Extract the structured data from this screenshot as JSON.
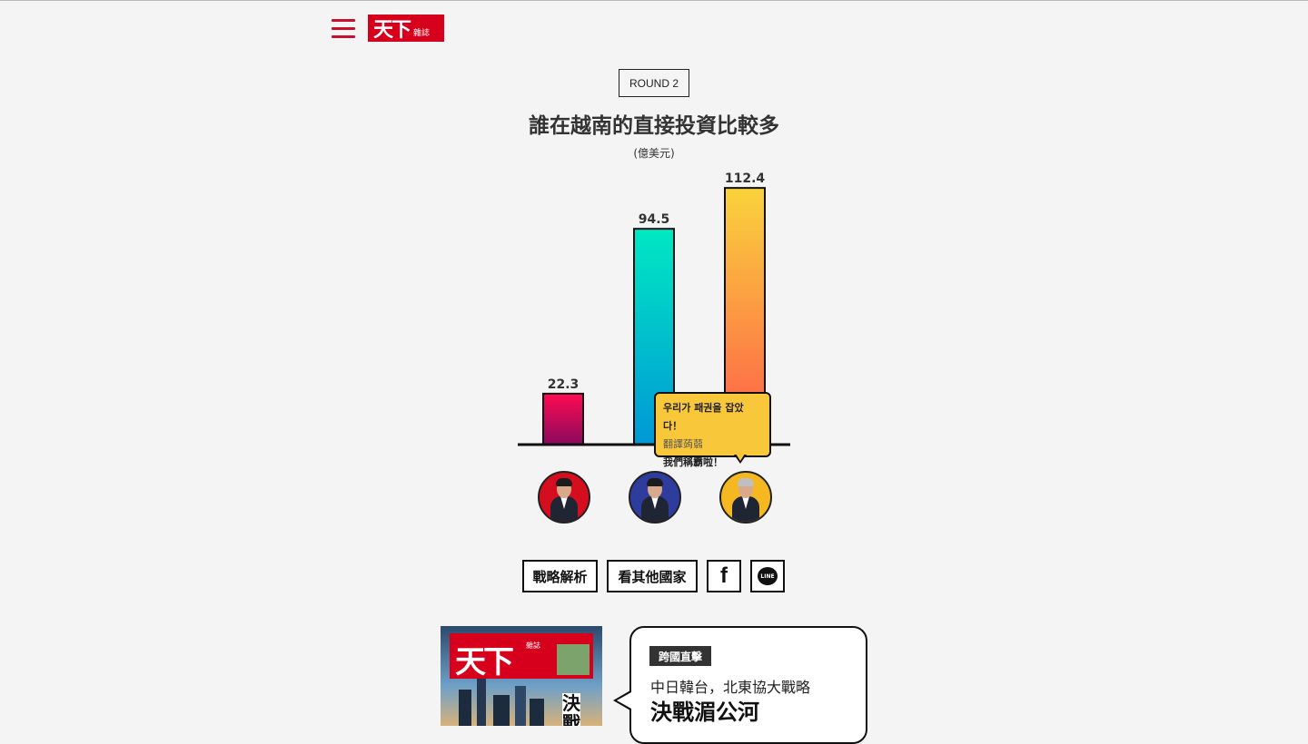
{
  "header": {
    "logo_main": "天下",
    "logo_small": "雜誌"
  },
  "round": "ROUND 2",
  "title": "誰在越南的直接投資比較多",
  "unit": "(億美元)",
  "chart_data": {
    "type": "bar",
    "title": "誰在越南的直接投資比較多",
    "ylabel": "(億美元)",
    "categories": [
      "",
      "",
      ""
    ],
    "values": [
      22.3,
      94.5,
      112.4
    ],
    "value_labels": [
      "22.3",
      "94.5",
      "112.4"
    ],
    "ylim": [
      0,
      120
    ],
    "grid": false,
    "legend": "none",
    "bar_gradients": [
      [
        "#ff0a52",
        "#8a0a5e"
      ],
      [
        "#00e8c2",
        "#0098d6"
      ],
      [
        "#f9d33c",
        "#ff5a4a"
      ]
    ]
  },
  "avatar_colors": [
    "#d40e1f",
    "#2e3c9e",
    "#f5b820"
  ],
  "bubble": {
    "line1": "우리가 패권을 잡았다！",
    "line2": "翻譯蒟蒻",
    "line3": "我們稱霸啦！"
  },
  "buttons": {
    "analysis": "戰略解析",
    "other_countries": "看其他國家",
    "facebook_icon_text": "f",
    "line_icon_text": "LINE"
  },
  "promo": {
    "cover_mast": "天下",
    "cover_mast_small": "雜誌",
    "cover_big_char": "決戰",
    "tag": "跨國直擊",
    "subtitle": "中日韓台，北東協大戰略",
    "title": "決戰湄公河"
  }
}
